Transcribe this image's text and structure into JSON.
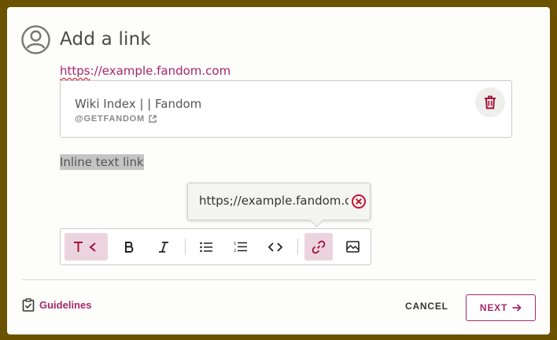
{
  "dialog": {
    "title": "Add a link",
    "url": "https://example.fandom.com",
    "url_misspelled_part": "https",
    "url_rest": "://example.fandom.com"
  },
  "preview": {
    "title": "Wiki Index |  | Fandom",
    "site": "@GETFANDOM"
  },
  "inline_link_text": "Inline text link",
  "popover": {
    "url_value": "https;//example.fandom.com"
  },
  "toolbar": {
    "buttons": [
      "text-style",
      "bold",
      "italic",
      "bulleted-list",
      "numbered-list",
      "code",
      "link",
      "image"
    ],
    "active": [
      "text-style",
      "link"
    ]
  },
  "footer": {
    "guidelines_label": "Guidelines",
    "cancel_label": "CANCEL",
    "next_label": "NEXT"
  },
  "colors": {
    "accent": "#a4286a",
    "error": "#c8102e",
    "backdrop": "#6b5200",
    "active_bg": "#ecd4df"
  }
}
